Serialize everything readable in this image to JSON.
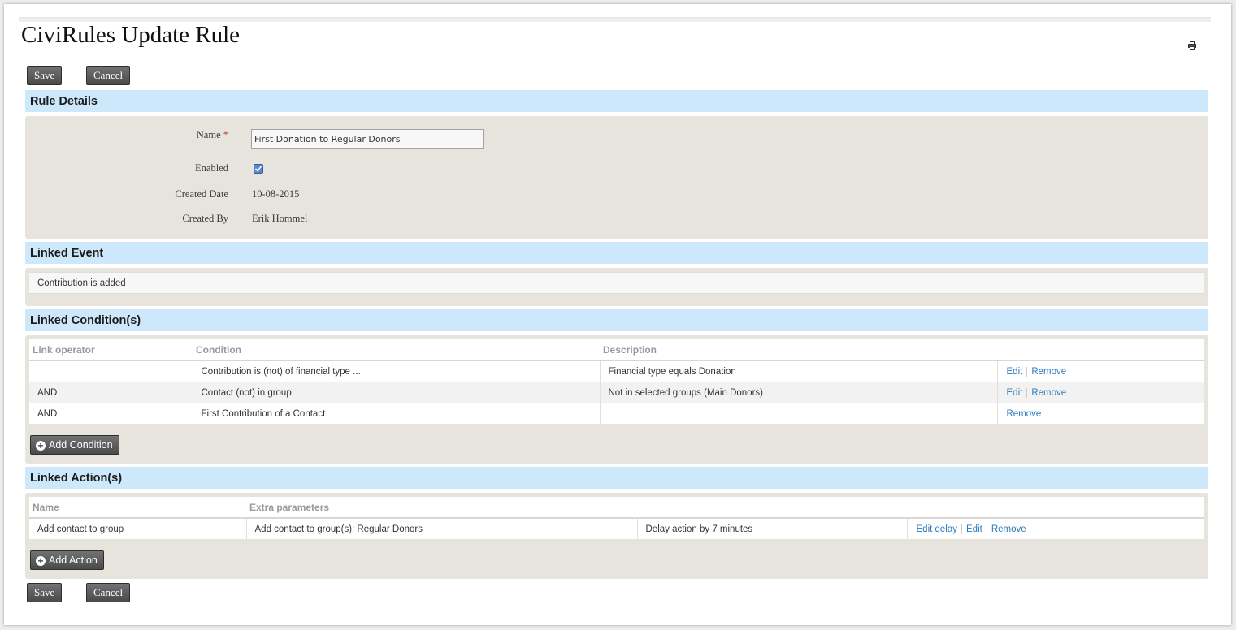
{
  "page": {
    "title": "CiviRules Update Rule",
    "print_icon": "print-icon"
  },
  "buttons": {
    "save": "Save",
    "cancel": "Cancel",
    "add_condition": "Add Condition",
    "add_action": "Add Action",
    "add_icon": "plus-circle-icon"
  },
  "rule_details": {
    "header": "Rule Details",
    "name_label": "Name",
    "required_marker": "*",
    "name_value": "First Donation to Regular Donors",
    "enabled_label": "Enabled",
    "enabled_checked": true,
    "created_date_label": "Created Date",
    "created_date": "10-08-2015",
    "created_by_label": "Created By",
    "created_by": "Erik Hommel"
  },
  "linked_event": {
    "header": "Linked Event",
    "value": "Contribution is added"
  },
  "linked_conditions": {
    "header": "Linked Condition(s)",
    "columns": [
      "Link operator",
      "Condition",
      "Description"
    ],
    "rows": [
      {
        "operator": "",
        "condition": "Contribution is (not) of financial type ...",
        "description": "Financial type equals Donation",
        "actions": [
          "Edit",
          "Remove"
        ]
      },
      {
        "operator": "AND",
        "condition": "Contact (not) in group",
        "description": "Not in selected groups (Main Donors)",
        "actions": [
          "Edit",
          "Remove"
        ]
      },
      {
        "operator": "AND",
        "condition": "First Contribution of a Contact",
        "description": "",
        "actions": [
          "Remove"
        ]
      }
    ]
  },
  "linked_actions": {
    "header": "Linked Action(s)",
    "columns": [
      "Name",
      "Extra parameters"
    ],
    "rows": [
      {
        "name": "Add contact to group",
        "parameters": "Add contact to group(s): Regular Donors",
        "delay": "Delay action by 7 minutes",
        "actions": [
          "Edit delay",
          "Edit",
          "Remove"
        ]
      }
    ]
  },
  "colors": {
    "section_header_bg": "#cde7fb",
    "section_body_bg": "#e6e4dc",
    "link": "#2a7bc0",
    "required": "#c4402b"
  }
}
